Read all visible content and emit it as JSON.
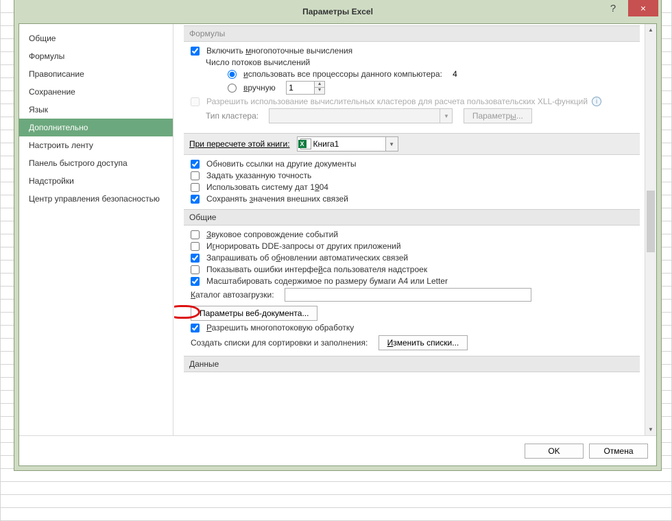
{
  "window": {
    "title": "Параметры Excel",
    "help": "?",
    "close": "×"
  },
  "sidebar": {
    "items": [
      "Общие",
      "Формулы",
      "Правописание",
      "Сохранение",
      "Язык",
      "Дополнительно",
      "Настроить ленту",
      "Панель быстрого доступа",
      "Надстройки",
      "Центр управления безопасностью"
    ],
    "selectedIndex": 5
  },
  "formulas": {
    "header": "Формулы",
    "multithread": "Включить многопоточные вычисления",
    "multithread_u": "м",
    "threadCountLabel": "Число потоков вычислений",
    "useAll": "использовать все процессоры данного компьютера:",
    "useAll_u": "и",
    "cpuCount": "4",
    "manual": "вручную",
    "manual_u": "в",
    "manualValue": "1",
    "allowClusters": "Разрешить использование вычислительных кластеров для расчета пользовательских XLL-функций",
    "clusterType": "Тип кластера:",
    "clusterParamsBtn": "Параметры..."
  },
  "recalc": {
    "label": "При пересчете этой книги:",
    "book": "Книга1"
  },
  "recalcOpts": {
    "updateLinks": "Обновить ссылки на другие документы",
    "setPrecision": "Задать указанную точность",
    "setPrecision_u": "у",
    "date1904": "Использовать систему дат 1904",
    "date1904_u": "9",
    "saveExt": "Сохранять значения внешних связей",
    "saveExt_u": "з"
  },
  "general": {
    "header": "Общие",
    "sound": "Звуковое сопровождение событий",
    "sound_u": "З",
    "ignoreDDE": "Игнорировать DDE-запросы от других приложений",
    "ignoreDDE_u": "г",
    "askUpdate": "Запрашивать об обновлении автоматических связей",
    "askUpdate_u": "б",
    "showAddinErr": "Показывать ошибки интерфейса пользователя надстроек",
    "showAddinErr_u": "й",
    "scaleA4": "Масштабировать содержимое по размеру бумаги A4 или Letter",
    "startupDir": "Каталог автозагрузки:",
    "startupDir_u": "К",
    "webDocBtn": "Параметры веб-документа...",
    "allowMulti": "Разрешить многопотоковую обработку",
    "allowMulti_u": "Р",
    "listsLabel": "Создать списки для сортировки и заполнения:",
    "editListsBtn": "Изменить списки...",
    "editListsBtn_u": "И"
  },
  "dataSection": {
    "header": "Данные"
  },
  "footer": {
    "ok": "OK",
    "cancel": "Отмена"
  }
}
